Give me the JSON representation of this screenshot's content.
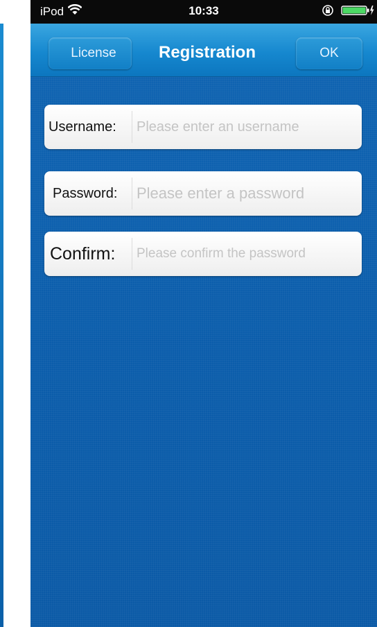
{
  "status_bar": {
    "carrier": "iPod",
    "time": "10:33",
    "icons": [
      "wifi-icon",
      "orientation-lock-icon",
      "battery-charging-icon"
    ]
  },
  "nav": {
    "back_label": "License",
    "title": "Registration",
    "ok_label": "OK"
  },
  "form": {
    "username": {
      "label": "Username:",
      "value": "",
      "placeholder": "Please enter an username"
    },
    "password": {
      "label": "Password:",
      "value": "",
      "placeholder": "Please enter a password"
    },
    "confirm": {
      "label": "Confirm:",
      "value": "",
      "placeholder": "Please confirm the password"
    }
  },
  "colors": {
    "nav_bar": "#1688cf",
    "background": "#0e62b0",
    "battery": "#4cd964"
  }
}
